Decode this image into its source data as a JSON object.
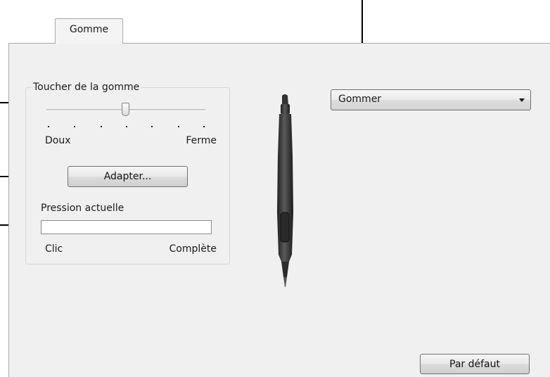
{
  "tabs": [
    {
      "label": "Gomme",
      "selected": true
    }
  ],
  "eraser_feel": {
    "group_title": "Toucher de la gomme",
    "slider": {
      "min_label": "Doux",
      "max_label": "Ferme",
      "tick_count": 7,
      "position_fraction": 0.5
    },
    "customize_button": "Adapter...",
    "current_pressure": {
      "label": "Pression actuelle",
      "min_label": "Clic",
      "max_label": "Complète",
      "level_fraction": 0
    }
  },
  "eraser_function": {
    "selected_value": "Gommer"
  },
  "footer": {
    "default_button": "Par défaut"
  },
  "colors": {
    "panel": "#f0f0f0",
    "border": "#a8a8a8",
    "callout": "#000000"
  },
  "icons": [
    "pen-illustration-icon",
    "chevron-down-icon"
  ]
}
